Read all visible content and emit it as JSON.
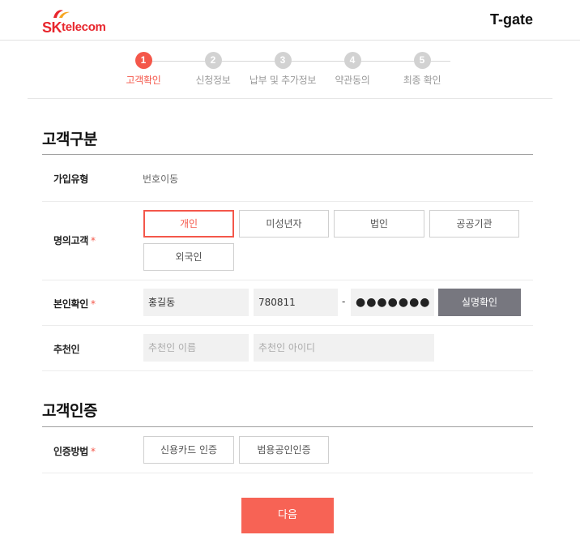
{
  "header": {
    "logo_sk": "SK",
    "logo_telecom": "telecom",
    "brand": "T-gate"
  },
  "steps": [
    {
      "num": "1",
      "label": "고객확인",
      "active": true
    },
    {
      "num": "2",
      "label": "신청정보",
      "active": false
    },
    {
      "num": "3",
      "label": "납부 및 추가정보",
      "active": false
    },
    {
      "num": "4",
      "label": "약관동의",
      "active": false
    },
    {
      "num": "5",
      "label": "최종 확인",
      "active": false
    }
  ],
  "customer_section": {
    "title": "고객구분",
    "join_type": {
      "label": "가입유형",
      "value": "번호이동"
    },
    "holder": {
      "label": "명의고객",
      "required_mark": "*",
      "options": [
        "개인",
        "미성년자",
        "법인",
        "공공기관",
        "외국인"
      ],
      "selected": "개인"
    },
    "identity": {
      "label": "본인확인",
      "required_mark": "*",
      "name_value": "홍길동",
      "birth_value": "780811",
      "separator": "-",
      "masked_value": "●●●●●●●",
      "verify_button": "실명확인"
    },
    "referrer": {
      "label": "추천인",
      "name_placeholder": "추천인 이름",
      "id_placeholder": "추천인 아이디"
    }
  },
  "auth_section": {
    "title": "고객인증",
    "method": {
      "label": "인증방법",
      "required_mark": "*",
      "options": [
        "신용카드 인증",
        "범용공인인증"
      ]
    }
  },
  "footer": {
    "next_button": "다음"
  },
  "colors": {
    "accent": "#f4574a",
    "brand_red": "#e8262d",
    "next_button": "#f76355",
    "verify_button": "#77777f",
    "inactive_step": "#d2d2d2"
  }
}
